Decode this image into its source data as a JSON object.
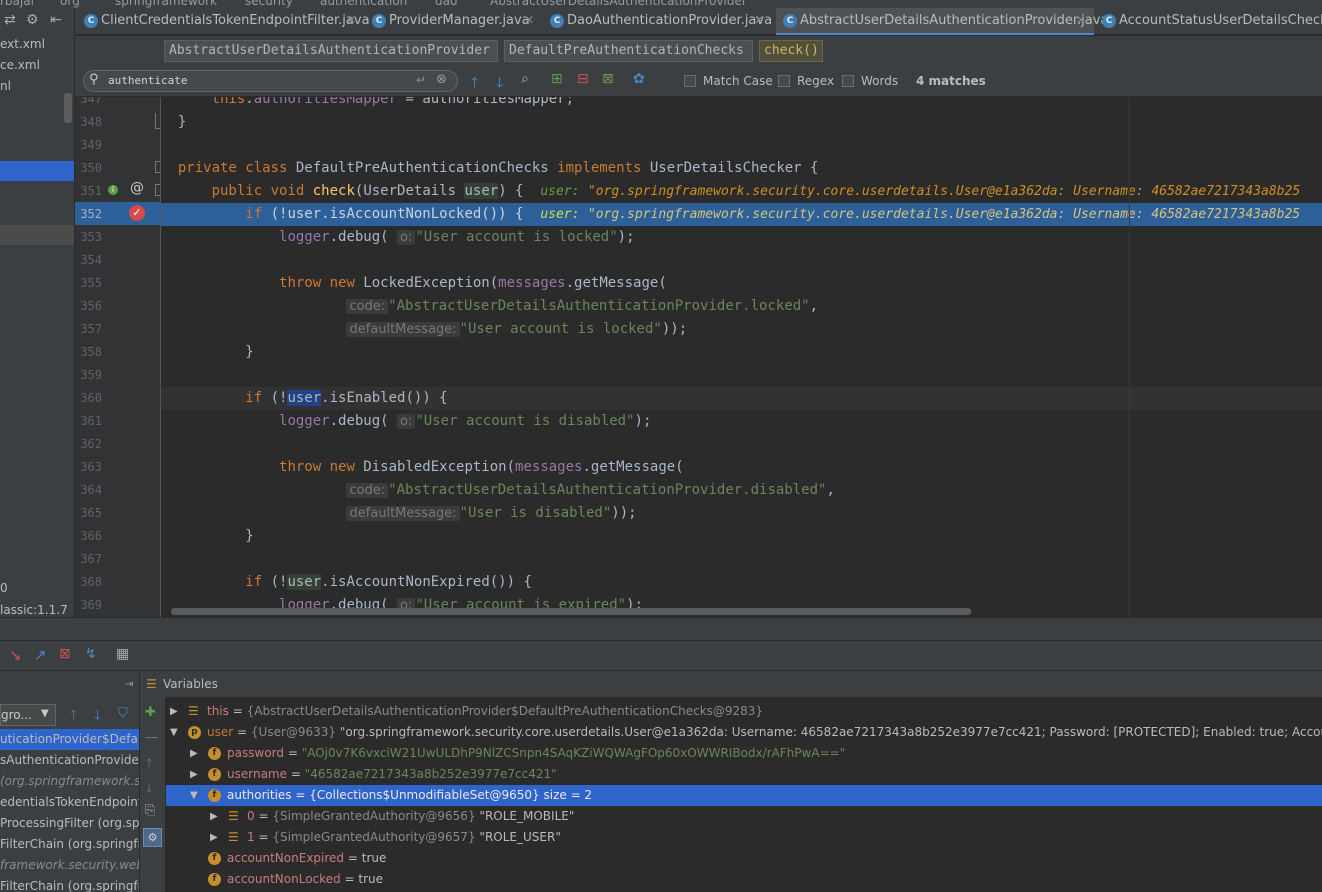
{
  "breadcrumbs_top": [
    "rbajai",
    "org",
    "springframework",
    "security",
    "authentication",
    "dao",
    "AbstractUserDetailsAuthenticationProvider"
  ],
  "tabs": [
    {
      "label": "ClientCredentialsTokenEndpointFilter.java",
      "active": false
    },
    {
      "label": "ProviderManager.java",
      "active": false
    },
    {
      "label": "DaoAuthenticationProvider.java",
      "active": false
    },
    {
      "label": "AbstractUserDetailsAuthenticationProvider.java",
      "active": true
    },
    {
      "label": "AccountStatusUserDetailsChecker.j",
      "active": false
    }
  ],
  "crumb_buttons": [
    "AbstractUserDetailsAuthenticationProvider",
    "DefaultPreAuthenticationChecks",
    "check()"
  ],
  "project_items": [
    "ext.xml",
    "ce.xml",
    "nl",
    "0",
    "lassic:1.1.7"
  ],
  "search": {
    "query": "authenticate",
    "match_case": "Match Case",
    "regex": "Regex",
    "words": "Words",
    "result": "4 matches"
  },
  "code": {
    "line_numbers": [
      "347",
      "348",
      "349",
      "350",
      "351",
      "352",
      "353",
      "354",
      "355",
      "356",
      "357",
      "358",
      "359",
      "360",
      "361",
      "362",
      "363",
      "364",
      "365",
      "366",
      "367",
      "368",
      "369"
    ],
    "inline_user_label": "user:",
    "inline_user_value": "\"org.springframework.security.core.userdetails.User@e1a362da: Username: 46582ae7217343a8b25",
    "hint_o": "o:",
    "hint_code": "code:",
    "hint_default": "defaultMessage:",
    "str_locked": "\"User account is locked\"",
    "str_locked_code": "\"AbstractUserDetailsAuthenticationProvider.locked\"",
    "str_disabled": "\"User account is disabled\"",
    "str_disabled_code": "\"AbstractUserDetailsAuthenticationProvider.disabled\"",
    "str_disabled_msg": "\"User is disabled\"",
    "str_expired": "\"User account is expired\""
  },
  "debug": {
    "variables_title": "Variables",
    "frames_dropdown": "gro...",
    "frames": [
      {
        "label": "uticationProvider$Defau",
        "selected": true
      },
      {
        "label": "sAuthenticationProvider",
        "selected": false
      },
      {
        "label": "(org.springframework.se",
        "selected": false
      },
      {
        "label": "edentialsTokenEndpointF",
        "selected": false
      },
      {
        "label": "ProcessingFilter (org.spr",
        "selected": false
      },
      {
        "label": "FilterChain (org.springfr",
        "selected": false
      },
      {
        "label": "framework.security.web",
        "selected": false
      },
      {
        "label": "FilterChain (org.springfr",
        "selected": false
      }
    ],
    "vars": [
      {
        "name": "this",
        "eq": "=",
        "type": "{AbstractUserDetailsAuthenticationProvider$DefaultPreAuthenticationChecks@9283}",
        "value": ""
      },
      {
        "name": "user",
        "eq": "=",
        "type": "{User@9633}",
        "value": "\"org.springframework.security.core.userdetails.User@e1a362da: Username: 46582ae7217343a8b252e3977e7cc421; Password: [PROTECTED]; Enabled: true; AccountNonExp"
      },
      {
        "name": "password",
        "eq": "=",
        "type": "",
        "value": "\"AOj0v7K6vxciW21UwULDhP9NlZCSnpn4SAqKZiWQWAgFOp60xOWWRIBodx/rAFhPwA==\""
      },
      {
        "name": "username",
        "eq": "=",
        "type": "",
        "value": "\"46582ae7217343a8b252e3977e7cc421\""
      },
      {
        "name": "authorities",
        "eq": "=",
        "type": "{Collections$UnmodifiableSet@9650}",
        "value": "size = 2"
      },
      {
        "name": "0",
        "eq": "=",
        "type": "{SimpleGrantedAuthority@9656}",
        "value": "\"ROLE_MOBILE\""
      },
      {
        "name": "1",
        "eq": "=",
        "type": "{SimpleGrantedAuthority@9657}",
        "value": "\"ROLE_USER\""
      },
      {
        "name": "accountNonExpired",
        "eq": "=",
        "type": "",
        "value": "true"
      },
      {
        "name": "accountNonLocked",
        "eq": "=",
        "type": "",
        "value": "true"
      }
    ]
  },
  "colors": {
    "accent": "#2f65ca",
    "highlight": "#2d6099",
    "keyword": "#cc7832",
    "string": "#6a8759"
  }
}
